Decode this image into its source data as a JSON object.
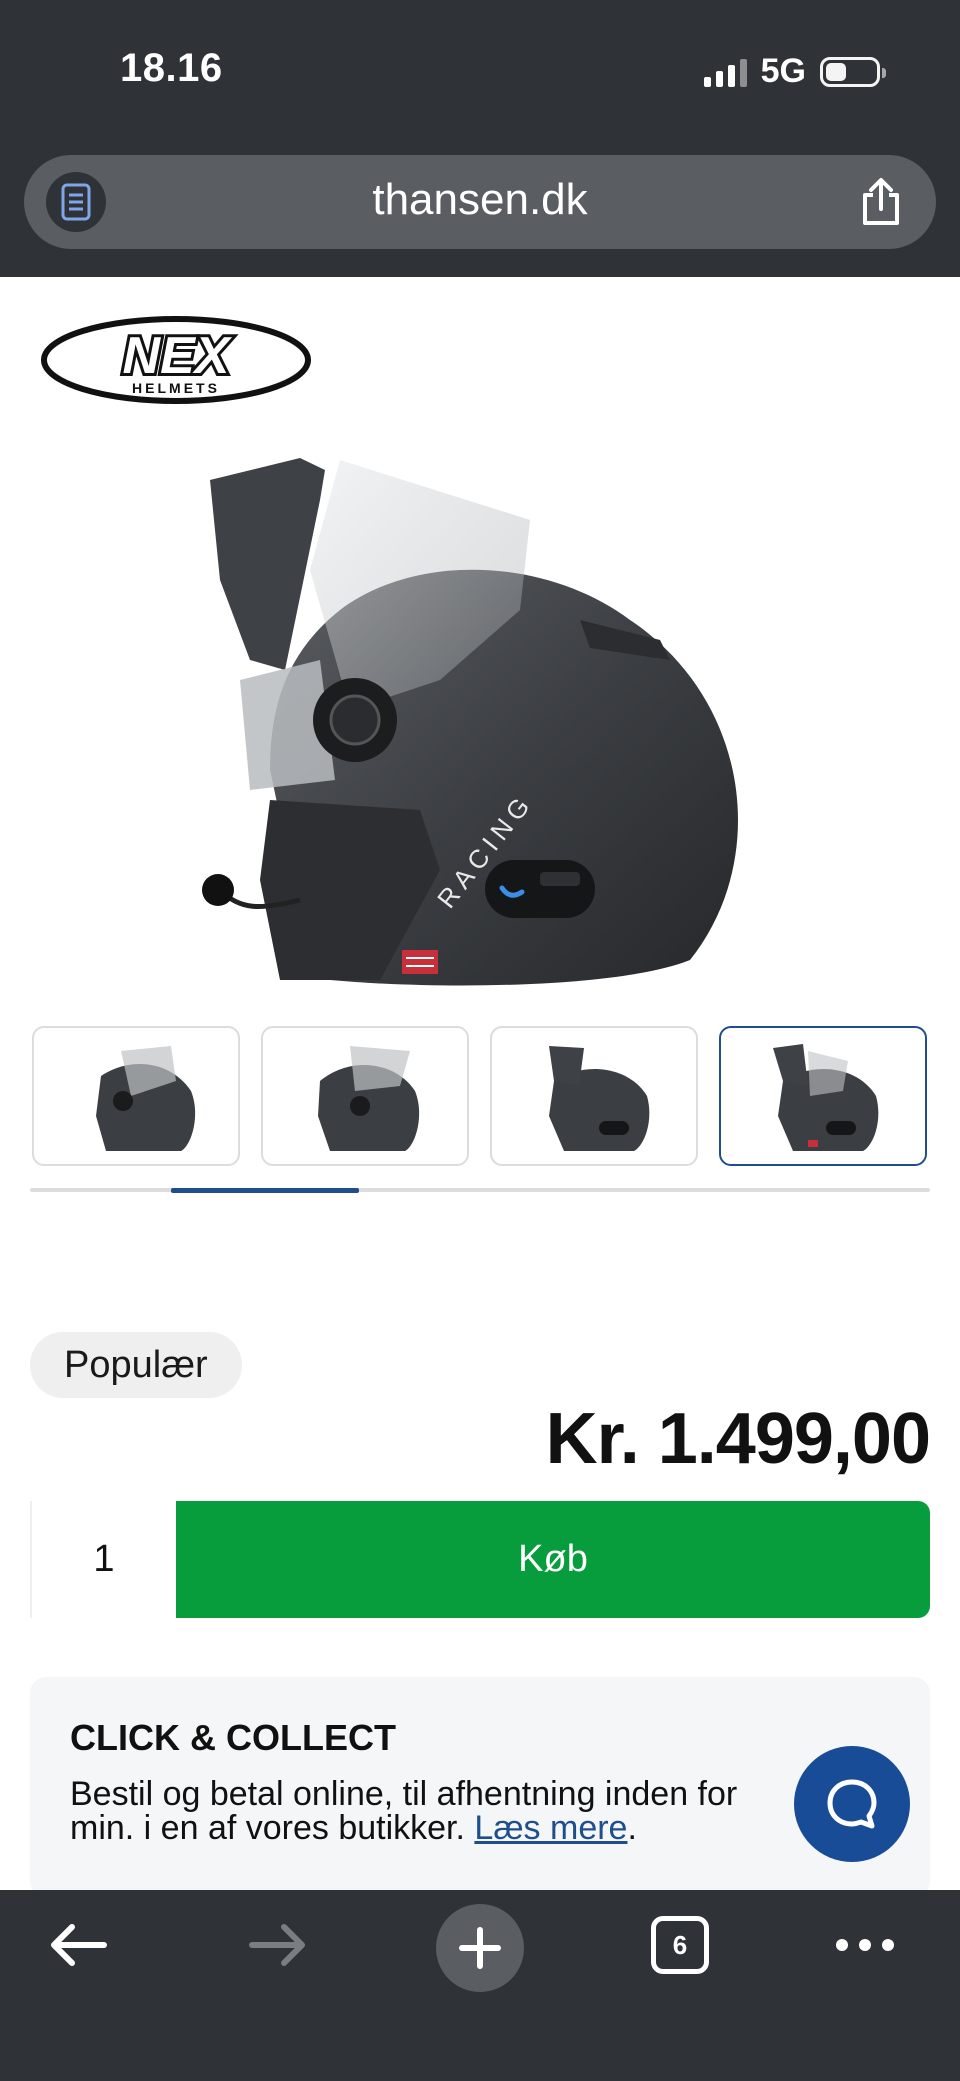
{
  "status_bar": {
    "time": "18.16",
    "network": "5G"
  },
  "browser": {
    "url": "thansen.dk",
    "open_tabs": "6"
  },
  "icons": {
    "reader": "reader-icon",
    "share": "share-icon",
    "back": "back-arrow-icon",
    "forward": "forward-arrow-icon",
    "new_tab": "plus-icon",
    "tabs": "tabs-icon",
    "more": "more-icon",
    "chat": "chat-bubble-icon"
  },
  "brand": {
    "logo_text": "NEX",
    "logo_subtext": "HELMETS"
  },
  "product": {
    "helmet_text": "RACING",
    "thumbnail_count": 4,
    "active_thumbnail": 4,
    "badge": "Populær",
    "price": "Kr. 1.499,00",
    "quantity": "1",
    "buy_label": "Køb"
  },
  "click_collect": {
    "title": "CLICK & COLLECT",
    "text_line1": "Bestil og betal online, til afhentning inden for",
    "text_line2": "min. i en af vores butikker.",
    "link": "Læs mere",
    "suffix": "."
  },
  "colors": {
    "chrome": "#2f3236",
    "buy_green": "#079c3c",
    "accent_blue": "#1f4e8c",
    "chat_blue": "#184c97"
  }
}
